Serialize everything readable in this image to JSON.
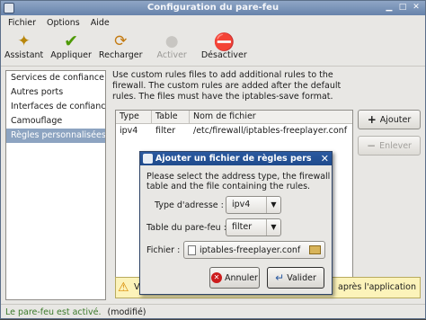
{
  "window": {
    "title": "Configuration du pare-feu"
  },
  "menu": {
    "items": [
      "Fichier",
      "Options",
      "Aide"
    ]
  },
  "toolbar": {
    "assistant": "Assistant",
    "appliquer": "Appliquer",
    "recharger": "Recharger",
    "activer": "Activer",
    "desactiver": "Désactiver"
  },
  "sidebar": {
    "items": [
      "Services de confiance",
      "Autres ports",
      "Interfaces de confiance",
      "Camouflage",
      "Règles personnalisées"
    ],
    "selected_index": 4
  },
  "content": {
    "info": "Use custom rules files to add additional rules to the firewall. The custom rules are added after the default rules. The files must have the iptables-save format.",
    "table": {
      "headers": [
        "Type",
        "Table",
        "Nom de fichier"
      ],
      "rows": [
        [
          "ipv4",
          "filter",
          "/etc/firewall/iptables-freeplayer.conf"
        ]
      ]
    },
    "add_button": "Ajouter",
    "remove_button": "Enlever",
    "warning_visible_start": "V",
    "warning_visible_end": "après l'application"
  },
  "status": {
    "text": "Le pare-feu est activé.",
    "modified": "(modifié)"
  },
  "dialog": {
    "title": "Ajouter un fichier de règles pers",
    "message": "Please select the address type, the firewall table and the file containing the rules.",
    "address_label": "Type d'adresse :",
    "address_value": "ipv4",
    "table_label": "Table du pare-feu :",
    "table_value": "filter",
    "file_label": "Fichier :",
    "file_value": "iptables-freeplayer.conf",
    "cancel": "Annuler",
    "ok": "Valider"
  },
  "colors": {
    "selection": "#8da4c1",
    "dialog_title": "#2b5aa0",
    "status_text": "#3b7a2a",
    "warning_bg": "#fcf3ba"
  }
}
